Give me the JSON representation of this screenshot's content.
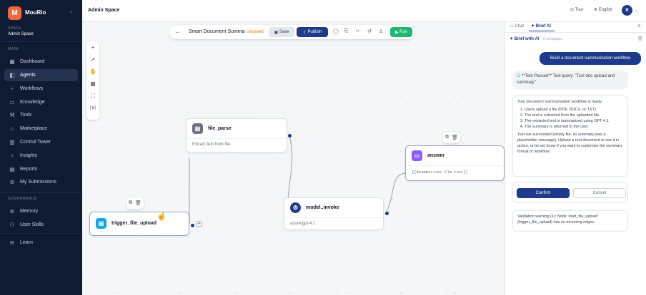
{
  "app": {
    "logo_letter": "M",
    "brand": "MouRio",
    "space_label": "SPACE",
    "space_name": "Admin Space"
  },
  "sidebar": {
    "main_label": "MAIN",
    "items": [
      {
        "label": "Dashboard",
        "icon": "dashboard-icon"
      },
      {
        "label": "Agents",
        "icon": "agents-icon"
      },
      {
        "label": "Workflows",
        "icon": "workflows-icon"
      },
      {
        "label": "Knowledge",
        "icon": "book-icon"
      },
      {
        "label": "Tools",
        "icon": "wrench-icon"
      },
      {
        "label": "Marketplace",
        "icon": "store-icon"
      },
      {
        "label": "Control Tower",
        "icon": "chart-icon"
      },
      {
        "label": "Insights",
        "icon": "lightbulb-icon"
      },
      {
        "label": "Reports",
        "icon": "report-icon"
      },
      {
        "label": "My Submissions",
        "icon": "submissions-icon"
      }
    ],
    "governance_label": "GOVERNANCE",
    "gov_items": [
      {
        "label": "Memory",
        "icon": "memory-icon"
      },
      {
        "label": "User Skills",
        "icon": "users-icon"
      }
    ],
    "learn": "Learn"
  },
  "topbar": {
    "title": "Admin Space",
    "tour": "Tour",
    "language": "English",
    "avatar": "R"
  },
  "toolbar": {
    "workflow_name": "Smart Document Summa",
    "status": "Unsaved",
    "save": "Save",
    "publish": "Publish",
    "run": "Run"
  },
  "nodes": {
    "file_parse": {
      "title": "file_parse",
      "body": "Extract text from file"
    },
    "answer": {
      "title": "answer",
      "body": "{{$summarizer.llm.text}}"
    },
    "model": {
      "title": "model..invoke",
      "body": "azure/gpt-4.1"
    },
    "trigger": {
      "title": "trigger_file_upload"
    }
  },
  "panel": {
    "tab_chat": "Chat",
    "tab_brief": "Brief AI",
    "brief_title": "Brief with AI",
    "message_count": "6 messages",
    "user_msg": "Build a document summarization workflow",
    "test_msg": "**Test Passed** Test query: \"Test doc upload and summary\"",
    "ready_intro": "Your document summarization workflow is ready:",
    "steps": [
      "Users upload a file (PDF, DOCX, or TXT).",
      "The text is extracted from the uploaded file.",
      "The extracted text is summarized using GPT-4.1.",
      "The summary is returned to the user."
    ],
    "ready_note": "Test run succeeded (empty file, so summary was a placeholder message). Upload a real document to see it in action, or let me know if you want to customize the summary format or workflow.",
    "confirm": "Confirm",
    "cancel": "Cancel",
    "warning": "Validation warning (1): Node 'start_file_upload' (trigger_file_upload) has no incoming edges."
  },
  "colors": {
    "sidebar": "#0f1b33",
    "accent": "#1e3a8a",
    "run": "#22b573",
    "brand": "#ee6a3c"
  }
}
